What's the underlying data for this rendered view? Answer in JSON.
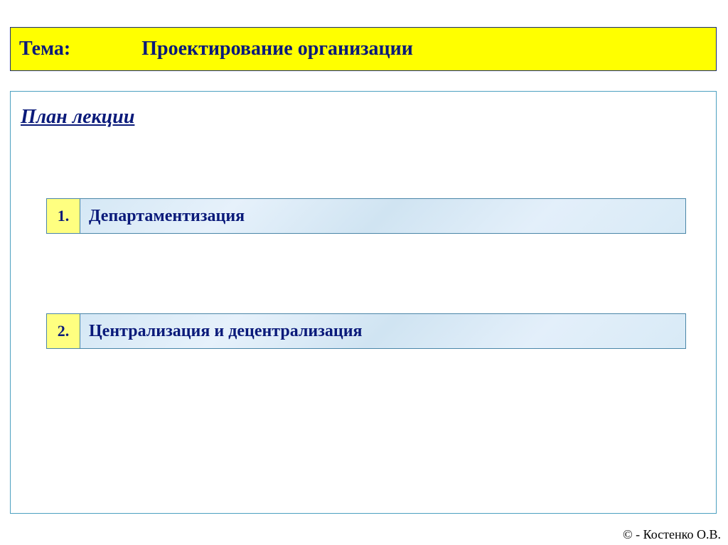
{
  "header": {
    "label": "Тема:",
    "title": "Проектирование организации"
  },
  "plan": {
    "title": "План лекции",
    "items": [
      {
        "num": "1.",
        "text": "Департаментизация"
      },
      {
        "num": "2.",
        "text": "Централизация и децентрализация"
      }
    ]
  },
  "footer": {
    "text": "© - Костенко О.В."
  }
}
